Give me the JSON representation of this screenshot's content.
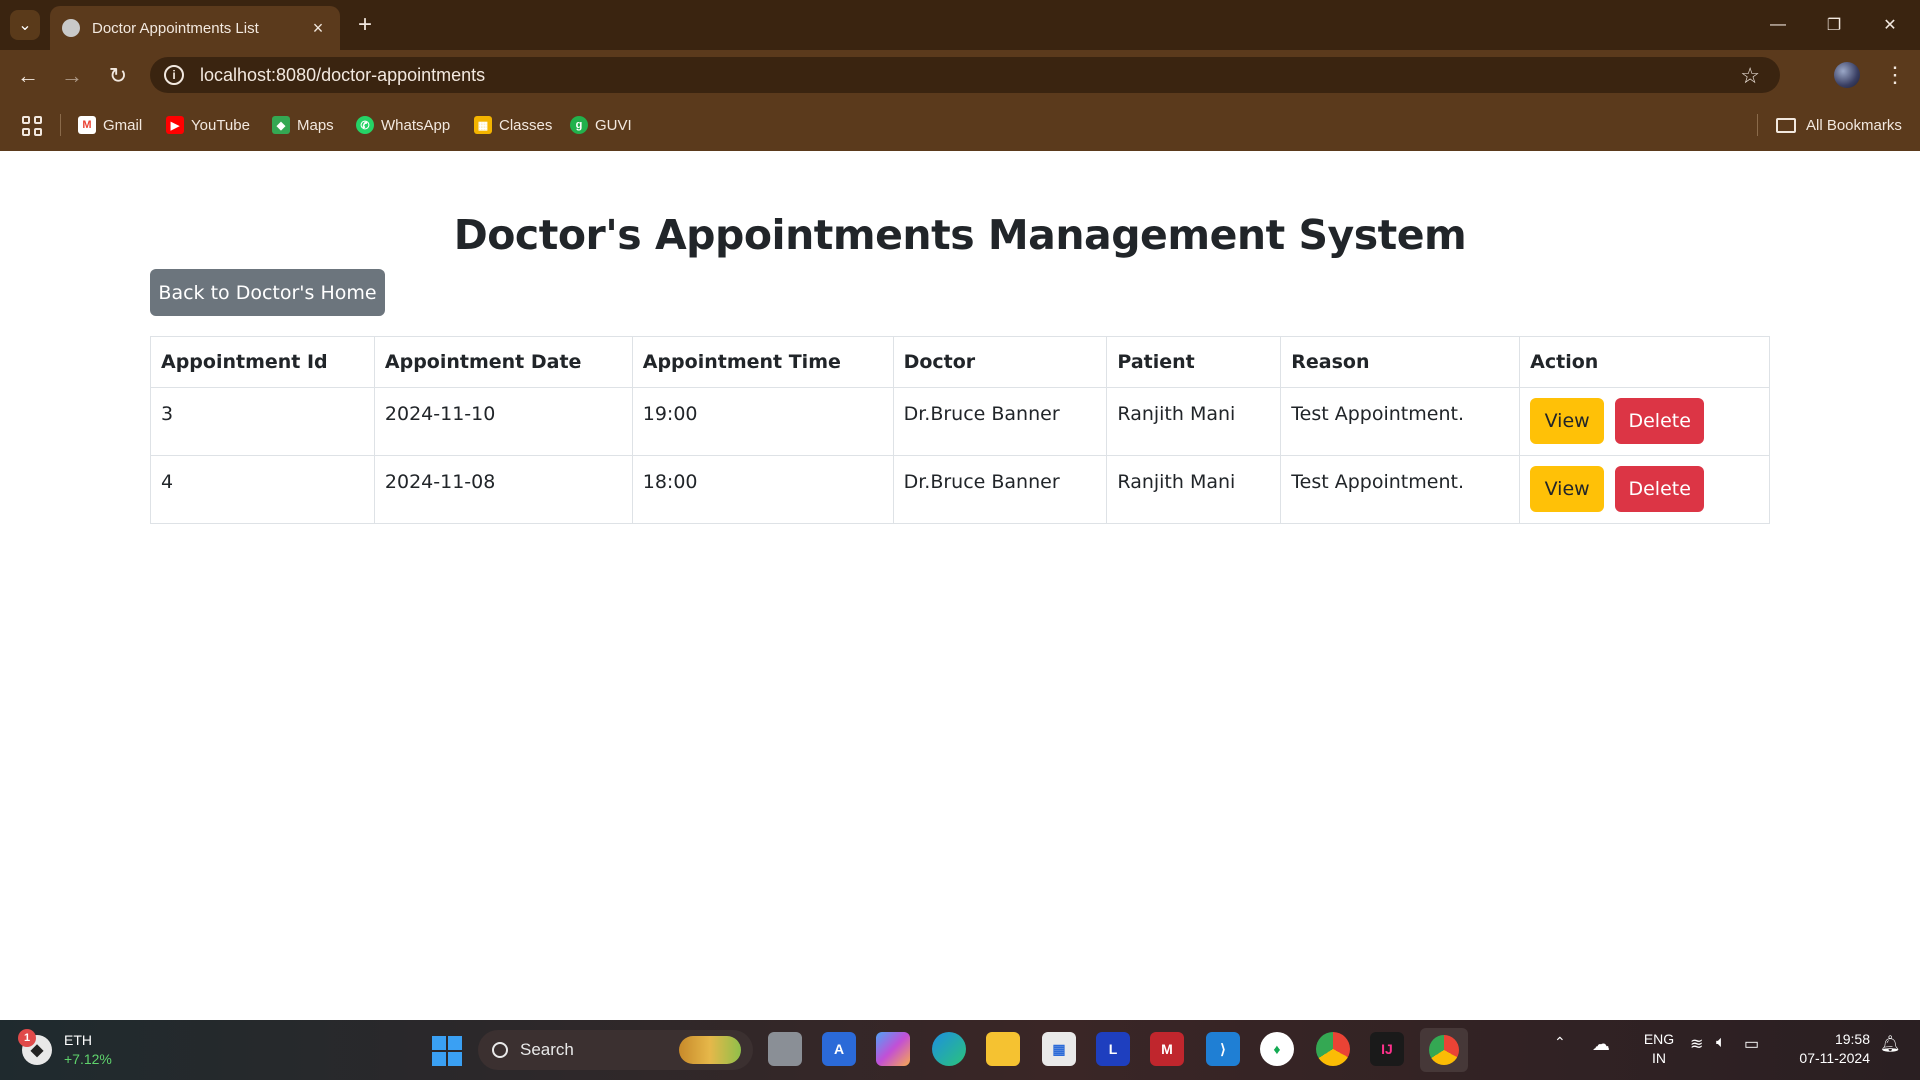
{
  "browser": {
    "tab_title": "Doctor Appointments List",
    "new_tab_symbol": "+",
    "url": "localhost:8080/doctor-appointments",
    "bookmarks": [
      {
        "label": "Gmail",
        "icon": "gmail-icon",
        "color": "#ea4335"
      },
      {
        "label": "YouTube",
        "icon": "youtube-icon",
        "color": "#ff0000"
      },
      {
        "label": "Maps",
        "icon": "maps-icon",
        "color": "#34a853"
      },
      {
        "label": "WhatsApp",
        "icon": "whatsapp-icon",
        "color": "#25d366"
      },
      {
        "label": "Classes",
        "icon": "classes-icon",
        "color": "#f4b400"
      },
      {
        "label": "GUVI",
        "icon": "guvi-icon",
        "color": "#22b14c"
      }
    ],
    "all_bookmarks": "All Bookmarks"
  },
  "page": {
    "title": "Doctor's Appointments Management System",
    "back_button": "Back to Doctor's Home",
    "table": {
      "headers": [
        "Appointment Id",
        "Appointment Date",
        "Appointment Time",
        "Doctor",
        "Patient",
        "Reason",
        "Action"
      ],
      "rows": [
        {
          "id": "3",
          "date": "2024-11-10",
          "time": "19:00",
          "doctor": "Dr.Bruce Banner",
          "patient": "Ranjith Mani",
          "reason": "Test Appointment."
        },
        {
          "id": "4",
          "date": "2024-11-08",
          "time": "18:00",
          "doctor": "Dr.Bruce Banner",
          "patient": "Ranjith Mani",
          "reason": "Test Appointment."
        }
      ],
      "view_label": "View",
      "delete_label": "Delete"
    }
  },
  "taskbar": {
    "widget_badge": "1",
    "widget_title": "ETH",
    "widget_change": "+7.12%",
    "search_label": "Search",
    "lang_line1": "ENG",
    "lang_line2": "IN",
    "time": "19:58",
    "date": "07-11-2024"
  },
  "colors": {
    "chrome_dark": "#3a2410",
    "chrome": "#5b3a1c",
    "secondary_button": "#6c757d",
    "view_button": "#ffc107",
    "delete_button": "#dc3545"
  }
}
